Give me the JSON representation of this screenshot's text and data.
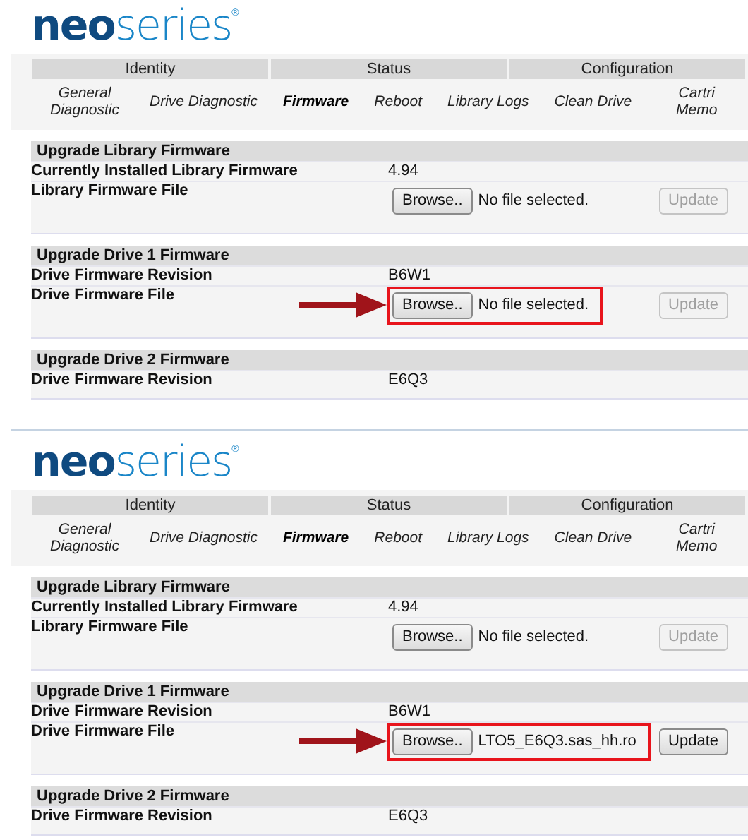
{
  "panels": [
    {
      "logo": {
        "bold": "neo",
        "light": "series",
        "mark": "®"
      },
      "nav_groups": [
        "Identity",
        "Status",
        "Configuration"
      ],
      "nav_items": [
        {
          "label": "General Diagnostic",
          "selected": false
        },
        {
          "label": "Drive Diagnostic",
          "selected": false
        },
        {
          "label": "Firmware",
          "selected": true
        },
        {
          "label": "Reboot",
          "selected": false
        },
        {
          "label": "Library Logs",
          "selected": false
        },
        {
          "label": "Clean Drive",
          "selected": false
        },
        {
          "label": "Cartri Memo",
          "selected": false
        }
      ],
      "sections": [
        {
          "title": "Upgrade Library Firmware",
          "rows": [
            {
              "kind": "value",
              "label": "Currently Installed Library Firmware",
              "value": "4.94"
            },
            {
              "kind": "file",
              "label": "Library Firmware File",
              "browse": "Browse..",
              "file": "No file selected.",
              "update": "Update",
              "update_disabled": true,
              "highlighted": false
            }
          ]
        },
        {
          "title": "Upgrade Drive 1 Firmware",
          "rows": [
            {
              "kind": "value",
              "label": "Drive Firmware Revision",
              "value": "B6W1"
            },
            {
              "kind": "file",
              "label": "Drive Firmware File",
              "browse": "Browse..",
              "file": "No file selected.",
              "update": "Update",
              "update_disabled": true,
              "highlighted": true
            }
          ]
        },
        {
          "title": "Upgrade Drive 2 Firmware",
          "rows": [
            {
              "kind": "value",
              "label": "Drive Firmware Revision",
              "value": "E6Q3"
            }
          ]
        }
      ]
    },
    {
      "logo": {
        "bold": "neo",
        "light": "series",
        "mark": "®"
      },
      "nav_groups": [
        "Identity",
        "Status",
        "Configuration"
      ],
      "nav_items": [
        {
          "label": "General Diagnostic",
          "selected": false
        },
        {
          "label": "Drive Diagnostic",
          "selected": false
        },
        {
          "label": "Firmware",
          "selected": true
        },
        {
          "label": "Reboot",
          "selected": false
        },
        {
          "label": "Library Logs",
          "selected": false
        },
        {
          "label": "Clean Drive",
          "selected": false
        },
        {
          "label": "Cartri Memo",
          "selected": false
        }
      ],
      "sections": [
        {
          "title": "Upgrade Library Firmware",
          "rows": [
            {
              "kind": "value",
              "label": "Currently Installed Library Firmware",
              "value": "4.94"
            },
            {
              "kind": "file",
              "label": "Library Firmware File",
              "browse": "Browse..",
              "file": "No file selected.",
              "update": "Update",
              "update_disabled": true,
              "highlighted": false
            }
          ]
        },
        {
          "title": "Upgrade Drive 1 Firmware",
          "rows": [
            {
              "kind": "value",
              "label": "Drive Firmware Revision",
              "value": "B6W1"
            },
            {
              "kind": "file",
              "label": "Drive Firmware File",
              "browse": "Browse..",
              "file": "LTO5_E6Q3.sas_hh.ro",
              "update": "Update",
              "update_disabled": false,
              "highlighted": true
            }
          ]
        },
        {
          "title": "Upgrade Drive 2 Firmware",
          "rows": [
            {
              "kind": "value",
              "label": "Drive Firmware Revision",
              "value": "E6Q3"
            }
          ]
        }
      ]
    }
  ]
}
